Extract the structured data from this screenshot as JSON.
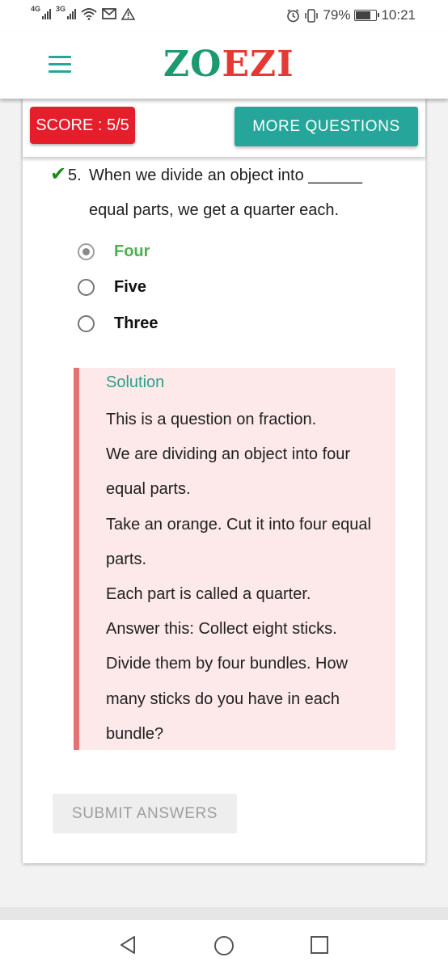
{
  "status_bar": {
    "network_1": "4G",
    "network_2": "3G",
    "battery_percent": "79%",
    "battery_level": 0.79,
    "time": "10:21",
    "icons": [
      "signal-icon",
      "signal-icon",
      "wifi-icon",
      "mail-icon",
      "warning-icon",
      "alarm-icon",
      "vibrate-icon",
      "battery-icon"
    ]
  },
  "header": {
    "logo_part1": "ZO",
    "logo_part2": "EZI",
    "menu_icon": "hamburger-menu-icon"
  },
  "colors": {
    "brand_teal": "#26a69a",
    "score_red": "#e41e2a",
    "correct_green": "#4caf50",
    "solution_bg": "#fde9ea",
    "solution_border": "#e57373"
  },
  "score_bar": {
    "score_label": "SCORE : 5/5",
    "more_button": "MORE QUESTIONS"
  },
  "question": {
    "number": "5.",
    "text_line1": "When we divide an object into ______",
    "text_line2": "equal parts, we get a quarter each.",
    "status_icon": "check-icon",
    "options": [
      {
        "label": "Four",
        "selected": true,
        "correct": true
      },
      {
        "label": "Five",
        "selected": false,
        "correct": false
      },
      {
        "label": "Three",
        "selected": false,
        "correct": false
      }
    ]
  },
  "solution": {
    "title": "Solution",
    "lines": [
      "This is a question on fraction.",
      "We are dividing an object into four",
      "equal parts.",
      "Take an orange. Cut it into four equal",
      "parts.",
      "Each part is called a quarter.",
      "Answer this: Collect eight sticks.",
      "Divide them by four bundles. How",
      "many sticks do you have in each",
      "bundle?"
    ]
  },
  "submit_button": "SUBMIT ANSWERS",
  "nav": {
    "back": "back-icon",
    "home": "home-icon",
    "recents": "recents-icon"
  }
}
